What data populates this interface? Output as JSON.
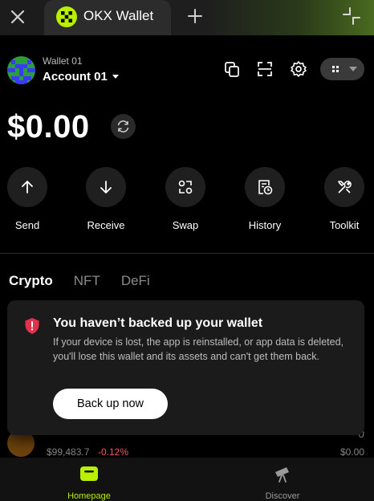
{
  "browser": {
    "tab_title": "OKX Wallet",
    "icons": [
      "close-icon",
      "plus-icon",
      "shrink-icon"
    ]
  },
  "header": {
    "wallet_label": "Wallet 01",
    "account_label": "Account 01",
    "icons": [
      "copy-icon",
      "scan-icon",
      "gear-icon",
      "grid-icon"
    ]
  },
  "balance": {
    "amount": "$0.00"
  },
  "actions": [
    {
      "label": "Send",
      "icon": "arrow-up-icon"
    },
    {
      "label": "Receive",
      "icon": "arrow-down-icon"
    },
    {
      "label": "Swap",
      "icon": "swap-icon"
    },
    {
      "label": "History",
      "icon": "history-icon"
    },
    {
      "label": "Toolkit",
      "icon": "toolkit-icon"
    }
  ],
  "asset_tabs": [
    {
      "label": "Crypto",
      "active": true
    },
    {
      "label": "NFT",
      "active": false
    },
    {
      "label": "DeFi",
      "active": false
    }
  ],
  "asset": {
    "price": "$99,483.7",
    "change": "-0.12%",
    "amount": "0",
    "value": "$0.00"
  },
  "backup_card": {
    "title": "You haven’t backed up your wallet",
    "body": "If your device is lost, the app is reinstalled, or app data is deleted, you'll lose this wallet and its assets and can't get them back.",
    "button": "Back up now"
  },
  "bottom_nav": [
    {
      "label": "Homepage",
      "active": true
    },
    {
      "label": "Discover",
      "active": false
    }
  ],
  "colors": {
    "accent": "#b8f000",
    "negative": "#ff5a6a",
    "warning": "#e0324a"
  }
}
